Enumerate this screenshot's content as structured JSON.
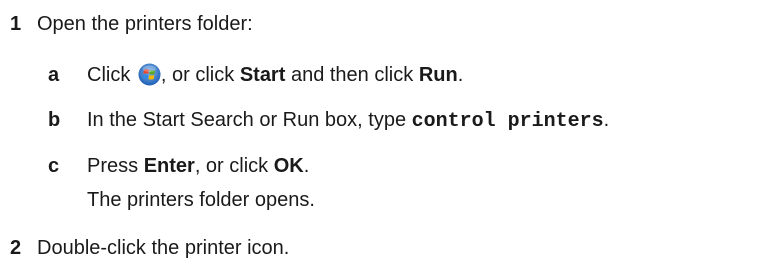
{
  "steps": [
    {
      "number": "1",
      "text": "Open the printers folder:"
    },
    {
      "number": "2",
      "text": "Double-click the printer icon."
    }
  ],
  "substeps": {
    "a": {
      "letter": "a",
      "click": "Click",
      "start_icon": "windows-start-orb-icon",
      "or_click": ", or click",
      "start": "Start",
      "and_then_click": "and then click",
      "run": "Run",
      "period": "."
    },
    "b": {
      "letter": "b",
      "prefix": "In the Start Search or Run box, type",
      "command": "control printers",
      "period": "."
    },
    "c": {
      "letter": "c",
      "press": "Press",
      "enter": "Enter",
      "or_click": ", or click",
      "ok": "OK",
      "period": ".",
      "result": "The printers folder opens."
    }
  },
  "colors": {
    "text": "#1a1a1a",
    "orb_blue": "#1e5fb4",
    "orb_red": "#e8452a",
    "orb_green": "#5aaa2a",
    "orb_yellow": "#f5b800"
  }
}
